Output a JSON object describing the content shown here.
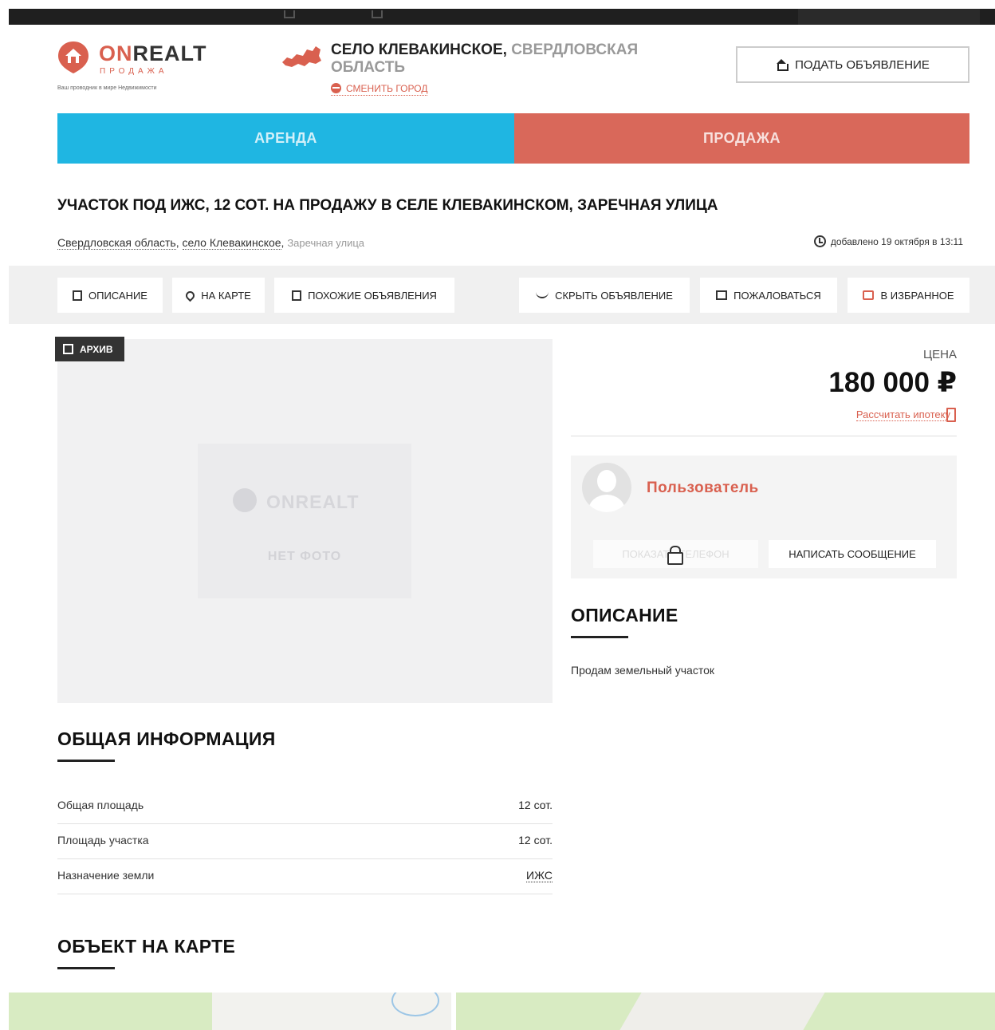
{
  "logo": {
    "name_on": "ON",
    "name_rest": "REALT",
    "sub": "ПРОДАЖА",
    "tagline": "Ваш проводник в мире Недвижимости"
  },
  "location": {
    "city": "СЕЛО КЛЕВАКИНСКОЕ,",
    "region": "СВЕРДЛОВСКАЯ ОБЛАСТЬ",
    "change": "СМЕНИТЬ ГОРОД"
  },
  "header": {
    "post_ad": "ПОДАТЬ ОБЪЯВЛЕНИЕ"
  },
  "nav": {
    "rent": "АРЕНДА",
    "sale": "ПРОДАЖА"
  },
  "listing": {
    "title": "УЧАСТОК ПОД ИЖС, 12 СОТ. НА ПРОДАЖУ В СЕЛЕ КЛЕВАКИНСКОМ, ЗАРЕЧНАЯ УЛИЦА",
    "address_region": "Свердловская область",
    "address_city": "село Клевакинское",
    "address_street": "Заречная улица",
    "added": "добавлено 19 октября в 13:11"
  },
  "actions": {
    "description": "ОПИСАНИЕ",
    "on_map": "НА КАРТЕ",
    "similar": "ПОХОЖИЕ ОБЪЯВЛЕНИЯ",
    "hide": "СКРЫТЬ ОБЪЯВЛЕНИЕ",
    "complain": "ПОЖАЛОВАТЬСЯ",
    "favorite": "В ИЗБРАННОЕ"
  },
  "photo": {
    "archive_badge": "АРХИВ",
    "placeholder_logo": "ONREALT",
    "no_photo": "НЕТ ФОТО"
  },
  "price": {
    "label": "ЦЕНА",
    "value": "180 000 ₽",
    "mortgage": "Рассчитать ипотеку"
  },
  "seller": {
    "name": "Пользователь",
    "show_phone": "ПОКАЗАТЬ ТЕЛЕФОН",
    "write": "НАПИСАТЬ СООБЩЕНИЕ"
  },
  "description": {
    "title": "ОПИСАНИЕ",
    "text": "Продам земельный участок"
  },
  "general_info": {
    "title": "ОБЩАЯ ИНФОРМАЦИЯ",
    "rows": [
      {
        "key": "Общая площадь",
        "value": "12 сот."
      },
      {
        "key": "Площадь участка",
        "value": "12 сот."
      },
      {
        "key": "Назначение земли",
        "value": "ИЖС"
      }
    ]
  },
  "map_section": {
    "title": "ОБЪЕКТ НА КАРТЕ"
  },
  "colors": {
    "accent": "#d9604f",
    "rent": "#1fb6e2",
    "sale": "#d9685a"
  }
}
